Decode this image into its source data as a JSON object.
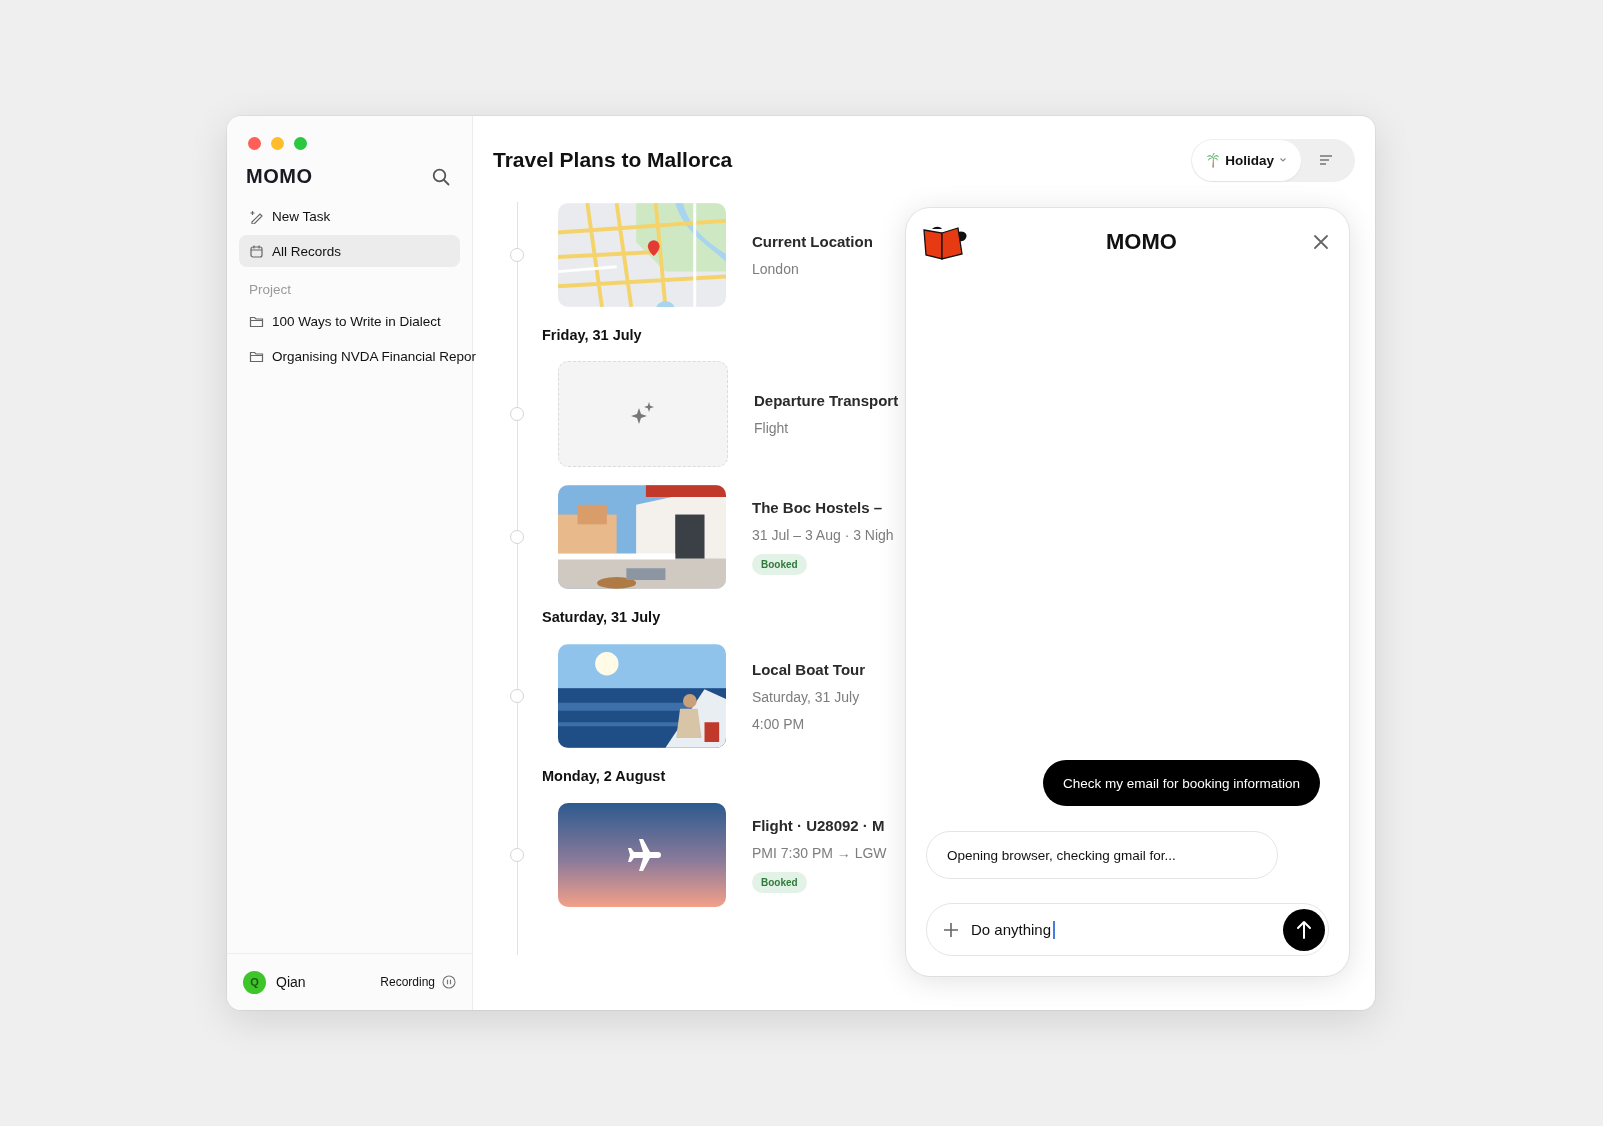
{
  "sidebar": {
    "brand": "MOMO",
    "items": [
      {
        "kind": "new_task",
        "label": "New Task",
        "selected": false
      },
      {
        "kind": "records",
        "label": "All Records",
        "selected": true
      }
    ],
    "section_label": "Project",
    "projects": [
      {
        "label": "100 Ways to Write in Dialect",
        "selected": false
      },
      {
        "label": "Organising NVDA Financial Repor",
        "selected": false
      }
    ],
    "user": {
      "initial": "Q",
      "name": "Qian"
    },
    "recording": {
      "label": "Recording"
    }
  },
  "main": {
    "title": "Travel Plans to Mallorca",
    "filter": {
      "label": "Holiday"
    },
    "timeline": [
      {
        "kind": "map",
        "title": "Current Location",
        "lines": [
          "London"
        ]
      },
      {
        "kind": "date",
        "label": "Friday, 31 July"
      },
      {
        "kind": "placeholder",
        "title": "Departure Transport",
        "lines": [
          "Flight"
        ]
      },
      {
        "kind": "hostel",
        "title": "The Boc Hostels –",
        "lines": [
          "31 Jul – 3 Aug · 3 Nigh"
        ],
        "badge": "Booked"
      },
      {
        "kind": "date",
        "label": "Saturday, 31 July"
      },
      {
        "kind": "sea",
        "title": "Local Boat Tour",
        "lines": [
          "Saturday, 31 July",
          "4:00 PM"
        ]
      },
      {
        "kind": "date",
        "label": "Monday, 2 August"
      },
      {
        "kind": "flight",
        "title": "Flight · U28092 · M",
        "lines": [
          "PMI 7:30 PM → LGW"
        ],
        "badge": "Booked"
      }
    ]
  },
  "chat": {
    "title": "MOMO",
    "messages": [
      {
        "kind": "user",
        "text": "Check my email for booking information"
      },
      {
        "kind": "assistant",
        "text": "Opening browser, checking gmail for..."
      }
    ],
    "input": {
      "value": "Do anything"
    }
  }
}
